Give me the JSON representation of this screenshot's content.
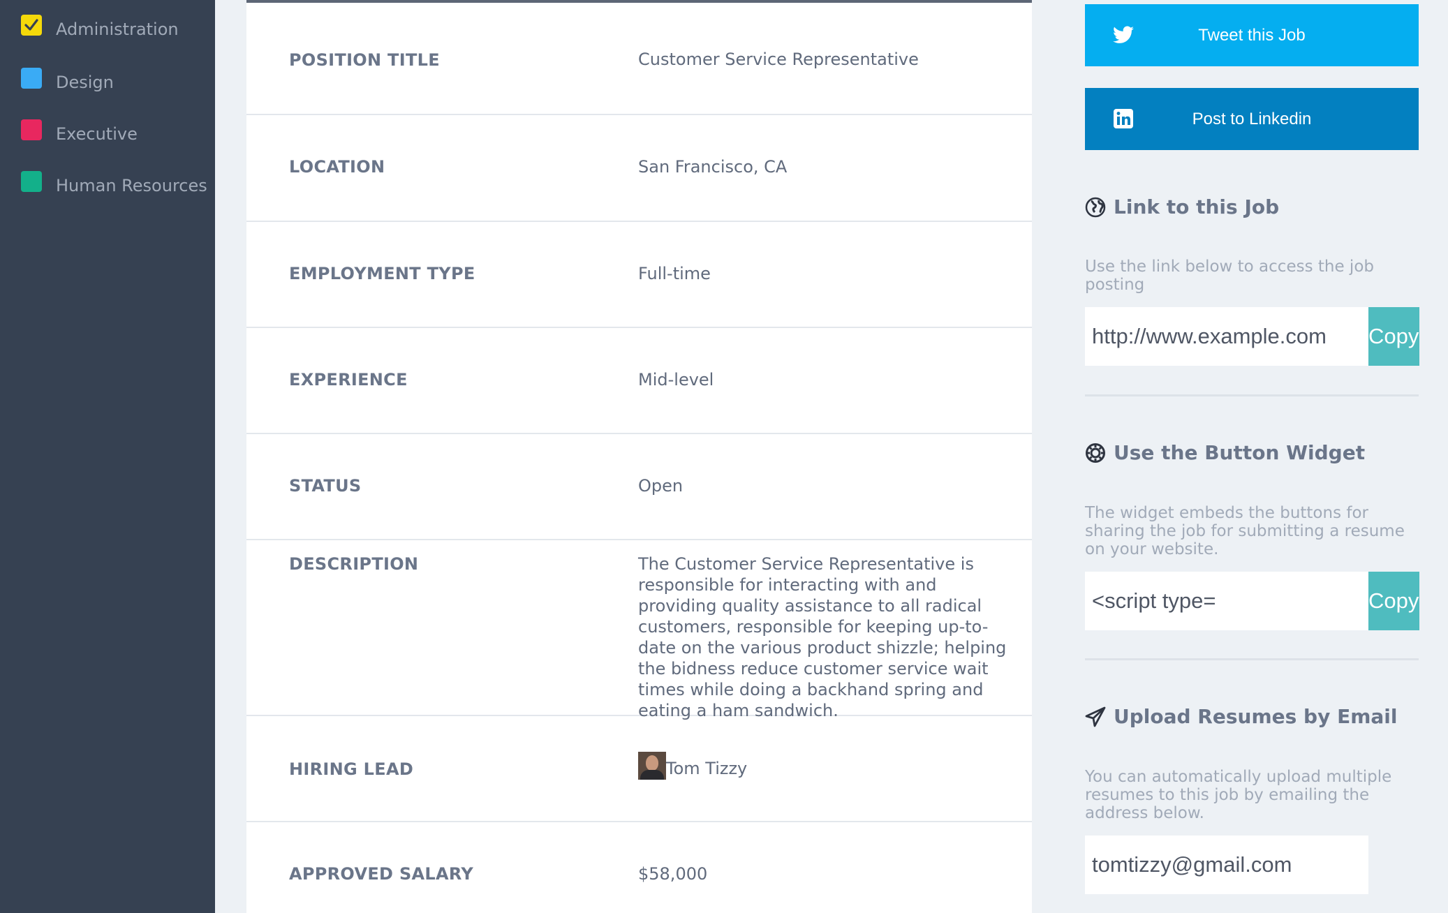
{
  "sidebar": {
    "items": [
      {
        "label": "Administration",
        "color": "#f5d90a",
        "checked": true
      },
      {
        "label": "Design",
        "color": "#3aabf5",
        "checked": false
      },
      {
        "label": "Executive",
        "color": "#e8275f",
        "checked": false
      },
      {
        "label": "Human Resources",
        "color": "#13b08a",
        "checked": false
      }
    ]
  },
  "job": {
    "position_title": {
      "label": "POSITION TITLE",
      "value": "Customer Service Representative"
    },
    "location": {
      "label": "LOCATION",
      "value": "San Francisco, CA"
    },
    "employment_type": {
      "label": "EMPLOYMENT TYPE",
      "value": "Full-time"
    },
    "experience": {
      "label": "EXPERIENCE",
      "value": "Mid-level"
    },
    "status": {
      "label": "STATUS",
      "value": "Open"
    },
    "description": {
      "label": "DESCRIPTION",
      "value": "The Customer Service Representative is responsible for interacting with and providing quality assistance to all radical customers, responsible for keeping up-to-date on the various product shizzle; helping the bidness reduce customer service wait times while doing a backhand spring and eating a ham sandwich."
    },
    "hiring_lead": {
      "label": "HIRING LEAD",
      "value": "Tom Tizzy"
    },
    "approved_salary": {
      "label": "APPROVED SALARY",
      "value": "$58,000"
    }
  },
  "share": {
    "tweet_label": "Tweet this Job",
    "tweet_color": "#05aef0",
    "linkedin_label": "Post to Linkedin",
    "linkedin_color": "#0380c0"
  },
  "link_section": {
    "title": "Link to this Job",
    "icon": "globe-icon",
    "description": "Use the link below to access the job posting",
    "field_value": "http://www.example.com",
    "copy_label": "Copy"
  },
  "widget_section": {
    "title": "Use the Button Widget",
    "icon": "gear-icon",
    "description": "The widget embeds the buttons for sharing the job for submitting a resume on your website.",
    "field_value": "<script type=",
    "copy_label": "Copy"
  },
  "email_section": {
    "title": "Upload Resumes by Email",
    "icon": "paper-plane-icon",
    "description": "You can automatically upload multiple resumes to this job by emailing the address below.",
    "field_value": "tomtizzy@gmail.com"
  },
  "colors": {
    "sidebar_bg": "#364152",
    "page_bg": "#edf1f5",
    "copy_button": "#4fbcbf"
  }
}
